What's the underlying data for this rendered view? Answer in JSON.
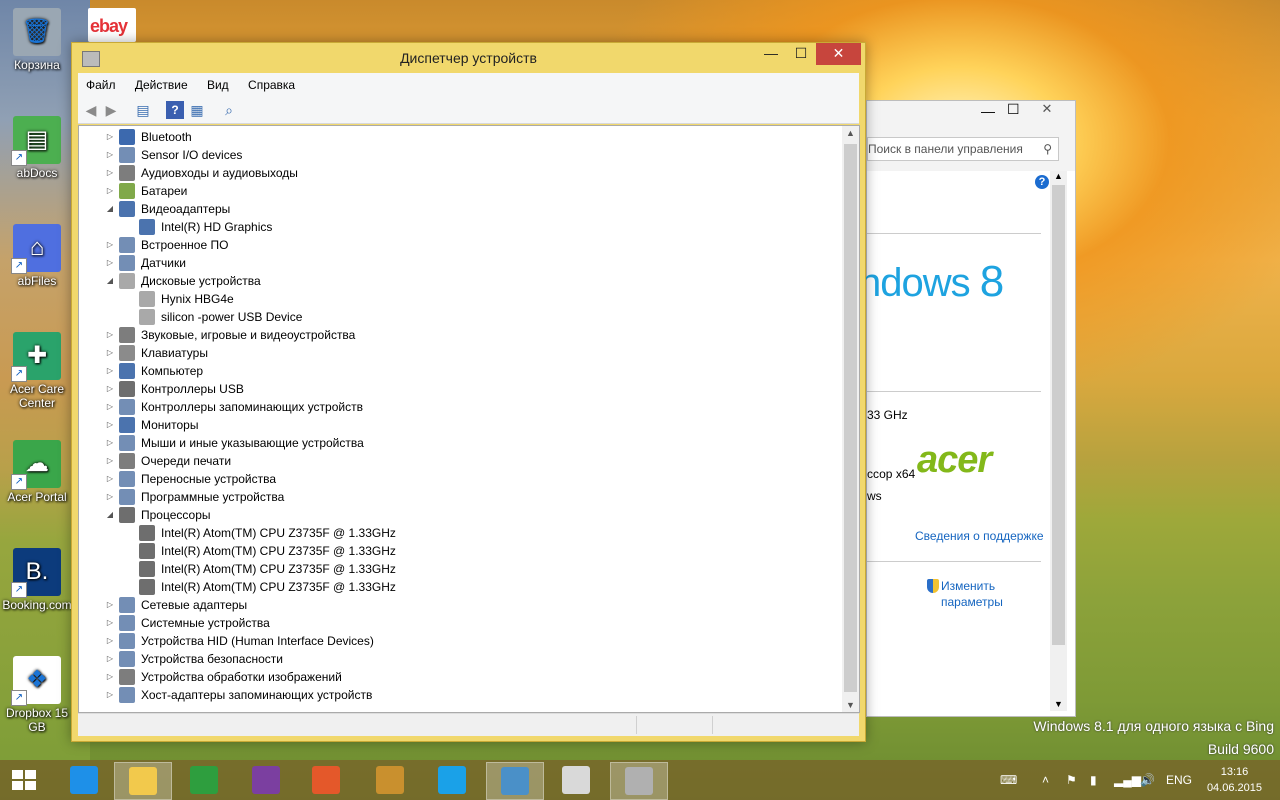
{
  "desktop": {
    "icons": [
      {
        "label": "Корзина",
        "color": "#9aa7b3",
        "glyph": "🗑"
      },
      {
        "label": "abDocs",
        "color": "#4caf50",
        "glyph": "▤"
      },
      {
        "label": "abFiles",
        "color": "#4f6fe0",
        "glyph": "⌂"
      },
      {
        "label": "Acer Care Center",
        "color": "#2aa36b",
        "glyph": "✚"
      },
      {
        "label": "Acer Portal",
        "color": "#3aa64a",
        "glyph": "☁"
      },
      {
        "label": "Booking.com",
        "color": "#0c3b7c",
        "glyph": "B."
      },
      {
        "label": "Dropbox 15 GB",
        "color": "#ffffff",
        "glyph": "❖"
      }
    ],
    "ebay_label": "ebay",
    "watermark_line1": "Windows 8.1 для одного языка с Bing",
    "watermark_line2": "Build 9600"
  },
  "devmgr": {
    "title": "Диспетчер устройств",
    "window_buttons": {
      "minimize": "—",
      "maximize": "☐",
      "close": "✕"
    },
    "menu": [
      "Файл",
      "Действие",
      "Вид",
      "Справка"
    ],
    "toolbar_icons": [
      "back-arrow-icon",
      "forward-arrow-icon",
      "properties-icon",
      "help-icon",
      "view-icon",
      "scan-hardware-icon"
    ],
    "tree": [
      {
        "label": "Bluetooth",
        "level": 0,
        "expander": "▷",
        "icon": "bluetooth-icon"
      },
      {
        "label": "Sensor I/O devices",
        "level": 0,
        "expander": "▷",
        "icon": "sensor-io-icon"
      },
      {
        "label": "Аудиовходы и аудиовыходы",
        "level": 0,
        "expander": "▷",
        "icon": "speaker-icon"
      },
      {
        "label": "Батареи",
        "level": 0,
        "expander": "▷",
        "icon": "battery-icon"
      },
      {
        "label": "Видеоадаптеры",
        "level": 0,
        "expander": "◢",
        "icon": "display-adapter-icon"
      },
      {
        "label": "Intel(R) HD Graphics",
        "level": 1,
        "expander": "",
        "icon": "display-adapter-icon"
      },
      {
        "label": "Встроенное ПО",
        "level": 0,
        "expander": "▷",
        "icon": "firmware-icon"
      },
      {
        "label": "Датчики",
        "level": 0,
        "expander": "▷",
        "icon": "sensor-icon"
      },
      {
        "label": "Дисковые устройства",
        "level": 0,
        "expander": "◢",
        "icon": "disk-icon"
      },
      {
        "label": "Hynix HBG4e",
        "level": 1,
        "expander": "",
        "icon": "disk-icon"
      },
      {
        "label": "silicon -power USB Device",
        "level": 1,
        "expander": "",
        "icon": "disk-icon"
      },
      {
        "label": "Звуковые, игровые и видеоустройства",
        "level": 0,
        "expander": "▷",
        "icon": "speaker-icon"
      },
      {
        "label": "Клавиатуры",
        "level": 0,
        "expander": "▷",
        "icon": "keyboard-icon"
      },
      {
        "label": "Компьютер",
        "level": 0,
        "expander": "▷",
        "icon": "computer-icon"
      },
      {
        "label": "Контроллеры USB",
        "level": 0,
        "expander": "▷",
        "icon": "usb-icon"
      },
      {
        "label": "Контроллеры запоминающих устройств",
        "level": 0,
        "expander": "▷",
        "icon": "storage-controller-icon"
      },
      {
        "label": "Мониторы",
        "level": 0,
        "expander": "▷",
        "icon": "monitor-icon"
      },
      {
        "label": "Мыши и иные указывающие устройства",
        "level": 0,
        "expander": "▷",
        "icon": "mouse-icon"
      },
      {
        "label": "Очереди печати",
        "level": 0,
        "expander": "▷",
        "icon": "printer-icon"
      },
      {
        "label": "Переносные устройства",
        "level": 0,
        "expander": "▷",
        "icon": "portable-device-icon"
      },
      {
        "label": "Программные устройства",
        "level": 0,
        "expander": "▷",
        "icon": "software-device-icon"
      },
      {
        "label": "Процессоры",
        "level": 0,
        "expander": "◢",
        "icon": "processor-icon"
      },
      {
        "label": "Intel(R) Atom(TM) CPU  Z3735F @ 1.33GHz",
        "level": 1,
        "expander": "",
        "icon": "processor-icon"
      },
      {
        "label": "Intel(R) Atom(TM) CPU  Z3735F @ 1.33GHz",
        "level": 1,
        "expander": "",
        "icon": "processor-icon"
      },
      {
        "label": "Intel(R) Atom(TM) CPU  Z3735F @ 1.33GHz",
        "level": 1,
        "expander": "",
        "icon": "processor-icon"
      },
      {
        "label": "Intel(R) Atom(TM) CPU  Z3735F @ 1.33GHz",
        "level": 1,
        "expander": "",
        "icon": "processor-icon"
      },
      {
        "label": "Сетевые адаптеры",
        "level": 0,
        "expander": "▷",
        "icon": "network-adapter-icon"
      },
      {
        "label": "Системные устройства",
        "level": 0,
        "expander": "▷",
        "icon": "system-device-icon"
      },
      {
        "label": "Устройства HID (Human Interface Devices)",
        "level": 0,
        "expander": "▷",
        "icon": "hid-icon"
      },
      {
        "label": "Устройства безопасности",
        "level": 0,
        "expander": "▷",
        "icon": "security-device-icon"
      },
      {
        "label": "Устройства обработки изображений",
        "level": 0,
        "expander": "▷",
        "icon": "camera-icon"
      },
      {
        "label": "Хост-адаптеры запоминающих устройств",
        "level": 0,
        "expander": "▷",
        "icon": "storage-host-icon"
      }
    ]
  },
  "control_panel": {
    "search_placeholder": "Поиск в панели управления",
    "help_glyph": "?",
    "windows_text": "ndows",
    "windows_version": "8",
    "cpu_speed": "33 GHz",
    "processor_type": "ссор x64",
    "os_fragment": "ws",
    "brand": "acer",
    "support_link": "Сведения о поддержке",
    "change_settings_line1": "Изменить",
    "change_settings_line2": "параметры"
  },
  "taskbar": {
    "start_icon": "windows-logo-icon",
    "apps": [
      {
        "name": "internet-explorer-icon",
        "color": "#1e90e8",
        "active": false
      },
      {
        "name": "file-explorer-icon",
        "color": "#f2c94c",
        "active": true
      },
      {
        "name": "store-icon",
        "color": "#2e9e3e",
        "active": false
      },
      {
        "name": "media-icon",
        "color": "#7b3fa0",
        "active": false
      },
      {
        "name": "photos-icon",
        "color": "#e4582a",
        "active": false
      },
      {
        "name": "reader-icon",
        "color": "#c9902e",
        "active": false
      },
      {
        "name": "skype-icon",
        "color": "#1aa1e8",
        "active": false
      },
      {
        "name": "control-panel-icon",
        "color": "#4a90c8",
        "active": true
      },
      {
        "name": "paint-icon",
        "color": "#d9d9d9",
        "active": false
      },
      {
        "name": "device-manager-icon",
        "color": "#b0b0b0",
        "active": true
      }
    ],
    "language": "ENG",
    "time": "13:16",
    "date": "04.06.2015"
  }
}
